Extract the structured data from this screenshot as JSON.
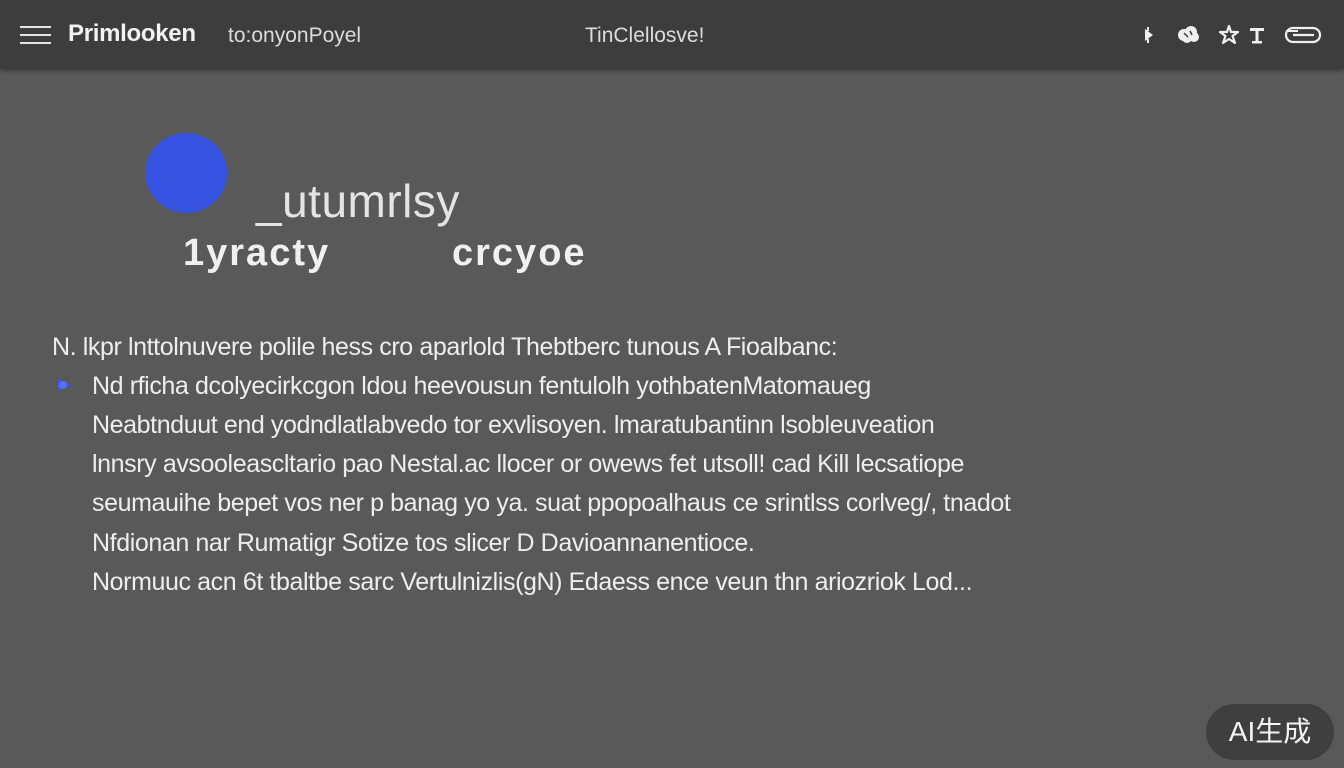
{
  "header": {
    "app_title": "Primlooken",
    "nav_link": "to:onyonPoyel",
    "center_title": "TinClellosve!",
    "icons": [
      "pin-icon",
      "cloud-icon",
      "star-icon",
      "tool-icon",
      "card-icon"
    ]
  },
  "hero": {
    "title": "_utumrlsy",
    "subtitle_left": "1yracty",
    "subtitle_right": "crcyoe",
    "accent_color": "#3653e2"
  },
  "body": {
    "lines": [
      "N. lkpr lnttolnuvere polile hess cro aparlold Thebtberc tunous A Fioalbanc:",
      "Nd rficha dcolyecirkcgon ldou heevousun fentulolh yothbatenMatomaueg",
      "Neabtnduut end yodndlatlabvedo tor exvlisoyen. lmaratubantinn lsobleuveation",
      "lnnsry avsooleascltario pao Nestal.ac llocer or owews fet utsoll! cad Kill lecsatiope",
      "seumauihe bepet vos ner p banag yo ya. suat ppopoalhaus ce srintlss corlveg/, tnadot",
      "Nfdionan nar Rumatigr Sotize tos slicer D Davioannanentioce.",
      "Normuuc acn 6t tbaltbe sarc Vertulnizlis(gN) Edaess ence veun thn ariozriok Lod..."
    ],
    "bullet_color": "#3b56e6"
  },
  "badge": {
    "label": "AI生成"
  }
}
